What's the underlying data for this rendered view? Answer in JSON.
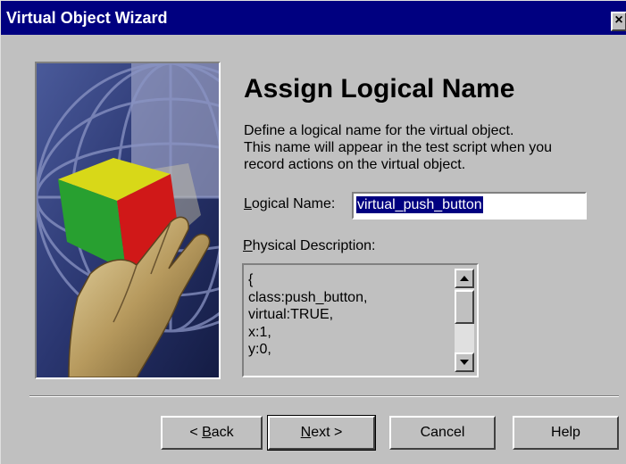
{
  "window": {
    "title": "Virtual Object Wizard",
    "close_glyph": "×"
  },
  "page": {
    "heading": "Assign Logical Name",
    "description": [
      "Define a logical name for the virtual object.",
      "This name will appear in the test script when you",
      "record actions on the virtual object."
    ]
  },
  "logical_name": {
    "label_mnemonic": "L",
    "label_rest": "ogical Name:",
    "value": "virtual_push_button"
  },
  "physical_description": {
    "label_mnemonic": "P",
    "label_rest": "hysical Description:",
    "lines": [
      "{",
      " class:push_button,",
      " virtual:TRUE,",
      " x:1,",
      " y:0,"
    ]
  },
  "buttons": {
    "back": {
      "prefix": "< ",
      "mnemonic": "B",
      "rest": "ack"
    },
    "next": {
      "mnemonic": "N",
      "rest": "ext >"
    },
    "cancel": "Cancel",
    "help": "Help"
  },
  "icons": {
    "close": "close-icon",
    "scroll_up": "triangle-up-icon",
    "scroll_down": "triangle-down-icon",
    "wizard_art": "hand-holding-cube-illustration"
  },
  "colors": {
    "titlebar": "#000080",
    "face": "#c0c0c0",
    "selection": "#000080"
  }
}
